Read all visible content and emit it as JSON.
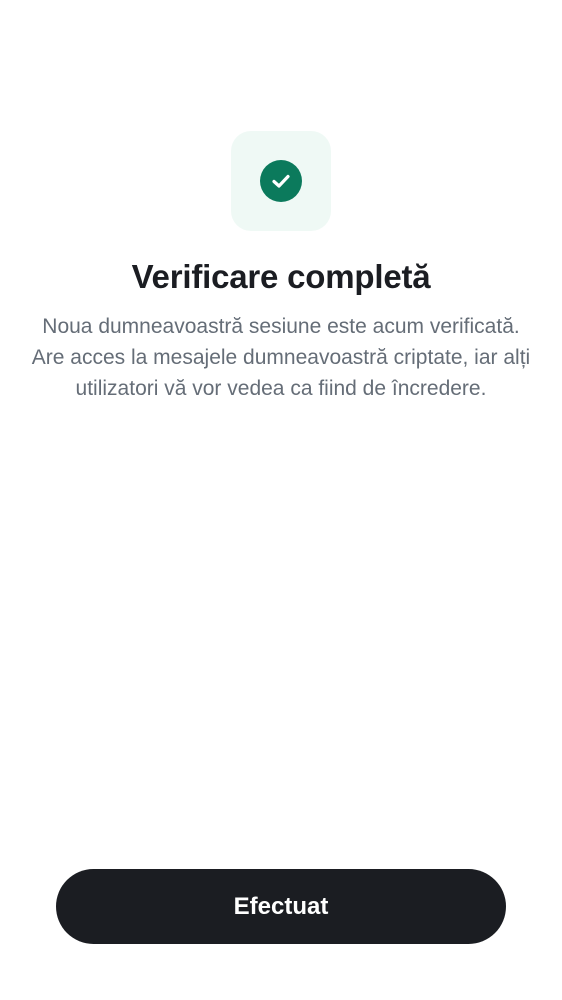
{
  "verification": {
    "icon": "check-circle-icon",
    "title": "Verificare completă",
    "description": "Noua dumneavoastră sesiune este acum verificată. Are acces la mesajele dumneavoastră criptate, iar alți utilizatori vă vor vedea ca fiind de încredere."
  },
  "actions": {
    "done_label": "Efectuat"
  },
  "colors": {
    "accent": "#0b7a5c",
    "icon_tile_background": "#eff9f5",
    "button_background": "#1b1d22",
    "title_text": "#1b1d22",
    "body_text": "#656d77"
  }
}
